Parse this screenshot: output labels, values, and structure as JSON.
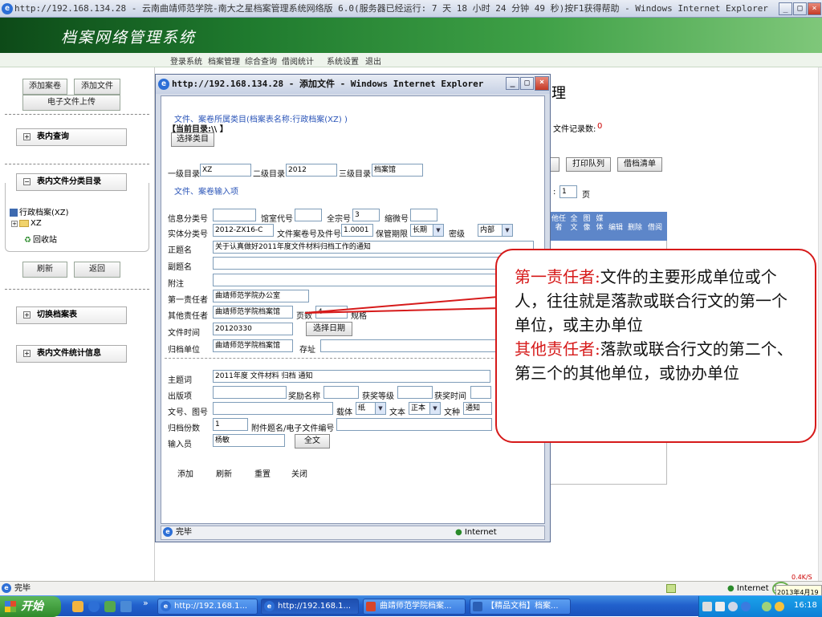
{
  "browser": {
    "title": "http://192.168.134.28 - 云南曲靖师范学院-南大之星档案管理系统网络版 6.0(服务器已经运行: 7 天 18 小时 24 分钟 49 秒)按F1获得帮助 - Windows Internet Explorer",
    "status": "完毕",
    "zone": "Internet"
  },
  "app": {
    "title": "档案网络管理系统",
    "menu": [
      "登录系统",
      "档案管理",
      "综合查询",
      "借阅统计",
      "系统设置",
      "退出"
    ]
  },
  "sidebar": {
    "buttons": [
      "添加案卷",
      "添加文件",
      "电子文件上传"
    ],
    "sections": {
      "query": "表内查询",
      "catalog": "表内文件分类目录",
      "switch": "切换档案表",
      "stats": "表内文件统计信息"
    },
    "tree": [
      "行政档案(XZ)",
      "XZ",
      "回收站"
    ],
    "refresh": "刷新",
    "back": "返回"
  },
  "background": {
    "heading_tail": "理",
    "record_count_label": "文件记录数:",
    "record_count_value": "0",
    "print_queue": "打印队列",
    "borrow_list": "借档清单",
    "page_value": "1",
    "page_suffix": "页",
    "col_headers": [
      "他任者",
      "全文",
      "图像",
      "媒体",
      "编辑",
      "删除",
      "借阅"
    ]
  },
  "dialog": {
    "title": "http://192.168.134.28 - 添加文件 - Windows Internet Explorer",
    "category_header": "文件、案卷所属类目(档案表名称:行政档案(XZ) )",
    "current_dir": "【当前目录:\\\\ 】",
    "choose_category": "选择类目",
    "level1_label": "一级目录",
    "level1_value": "XZ",
    "level2_label": "二级目录",
    "level2_value": "2012",
    "level3_label": "三级目录",
    "level3_value": "档案馆",
    "input_section": "文件、案卷输入项",
    "info_class_label": "信息分类号",
    "info_class_value": "",
    "room_code_label": "馆室代号",
    "room_code_value": "",
    "fonds_label": "全宗号",
    "fonds_value": "3",
    "micro_label": "缩微号",
    "micro_value": "",
    "entity_class_label": "实体分类号",
    "entity_class_value": "2012-ZX16-C",
    "file_no_label": "文件案卷号及件号",
    "file_no_value": "1.0001",
    "retention_label": "保管期限",
    "retention_value": "长期",
    "secret_label": "密级",
    "secret_value": "内部",
    "title_label": "正题名",
    "title_value": "关于认真做好2011年度文件材料归档工作的通知",
    "subtitle_label": "副题名",
    "subtitle_value": "",
    "note_label": "附注",
    "note_value": "",
    "first_resp_label": "第一责任者",
    "first_resp_value": "曲靖师范学院办公室",
    "other_resp_label": "其他责任者",
    "other_resp_value": "曲靖师范学院档案馆",
    "pages_label": "页数",
    "pages_value": "4",
    "volume_label": "规格",
    "file_time_label": "文件时间",
    "file_time_value": "20120330",
    "choose_date": "选择日期",
    "archive_unit_label": "归档单位",
    "archive_unit_value": "曲靖师范学院档案馆",
    "location_label": "存址",
    "location_value": "",
    "subject_label": "主题词",
    "subject_value": "2011年度  文件材料  归档  通知",
    "publish_label": "出版项",
    "publish_value": "",
    "award_label": "奖励名称",
    "award_value": "",
    "award_level_label": "获奖等级",
    "award_level_value": "",
    "award_time_label": "获奖时间",
    "award_time_value": "",
    "doc_no_label": "文号、图号",
    "doc_no_value": "",
    "carrier_label": "载体",
    "carrier_value": "纸",
    "text_label": "文本",
    "text_value": "正本",
    "type_label": "文种",
    "type_value": "通知",
    "copies_label": "归档份数",
    "copies_value": "1",
    "attach_label": "附件题名/电子文件编号",
    "attach_value": "",
    "entry_label": "输入员",
    "entry_value": "杨敏",
    "fulltext": "全文",
    "buttons": [
      "添加",
      "刷新",
      "重置",
      "关闭"
    ],
    "status": "完毕",
    "zone": "Internet"
  },
  "callout": {
    "t1": "第一责任者:",
    "d1": "文件的主要形成单位或个人，往往就是落款或联合行文的第一个单位，或主办单位",
    "t2": "其他责任者:",
    "d2": "落款或联合行文的第二个、第三个的其他单位，或协办单位"
  },
  "taskbar": {
    "start": "开始",
    "tasks": [
      "http://192.168.1...",
      "http://192.168.1...",
      "曲靖师范学院档案...",
      "【精品文档】档案..."
    ],
    "clock": "16:18",
    "date": "2013年4月19",
    "speed": "0.4K/S",
    "percent": "38%"
  }
}
